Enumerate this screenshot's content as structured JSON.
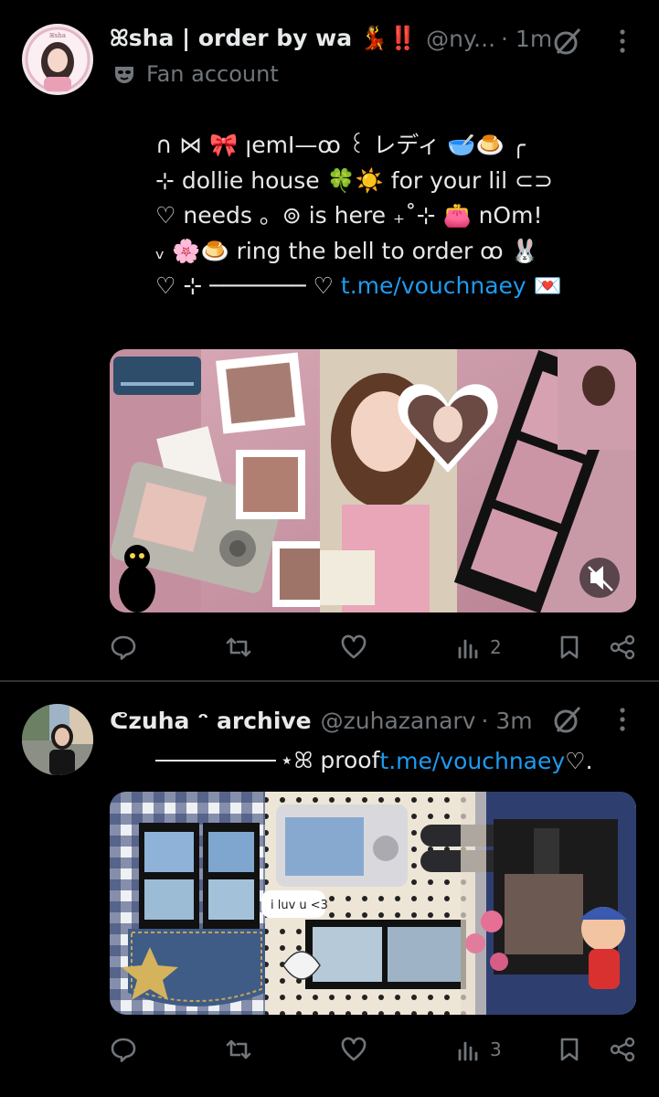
{
  "tweets": [
    {
      "display_name": "ꕤsha | order by wa 💃‼️",
      "handle": "@ny...",
      "time": "· 1m",
      "label": "Fan account",
      "bio_lines": [
        "∩ ⋈ 🎀 ꞁemI—ꝏ ꒰ レディ 🥣🍮 ╭",
        "⊹ dollie house 🍀☀️ for your lil ⊂⊃",
        "♡ needs 。⊚ is here ₊˚⊹ 👛 nOm!",
        "ᵥ 🌸🍮 ring the bell to order ꝏ 🐰",
        "♡ ⊹ ─────── ♡ "
      ],
      "link": "t.me/vouchnaey",
      "link_suffix": " 💌",
      "stats": {
        "views": "2"
      }
    },
    {
      "display_name": "ᕦzuha ᵔ archive",
      "handle": "@zuhazanarv",
      "time": "· 3m",
      "proof_prefix": "⋆ꕤ proof ",
      "link": "t.me/vouchnaey",
      "link_suffix": " ♡.",
      "stats": {
        "views": "3"
      }
    }
  ],
  "colors": {
    "background": "#000000",
    "text": "#e7e9ea",
    "muted": "#71767b",
    "link": "#1d9bf0",
    "divider": "#2f3336"
  },
  "icons": [
    "reply-icon",
    "retweet-icon",
    "like-icon",
    "views-icon",
    "bookmark-icon",
    "share-icon",
    "grok-icon",
    "more-icon",
    "mask-icon"
  ]
}
